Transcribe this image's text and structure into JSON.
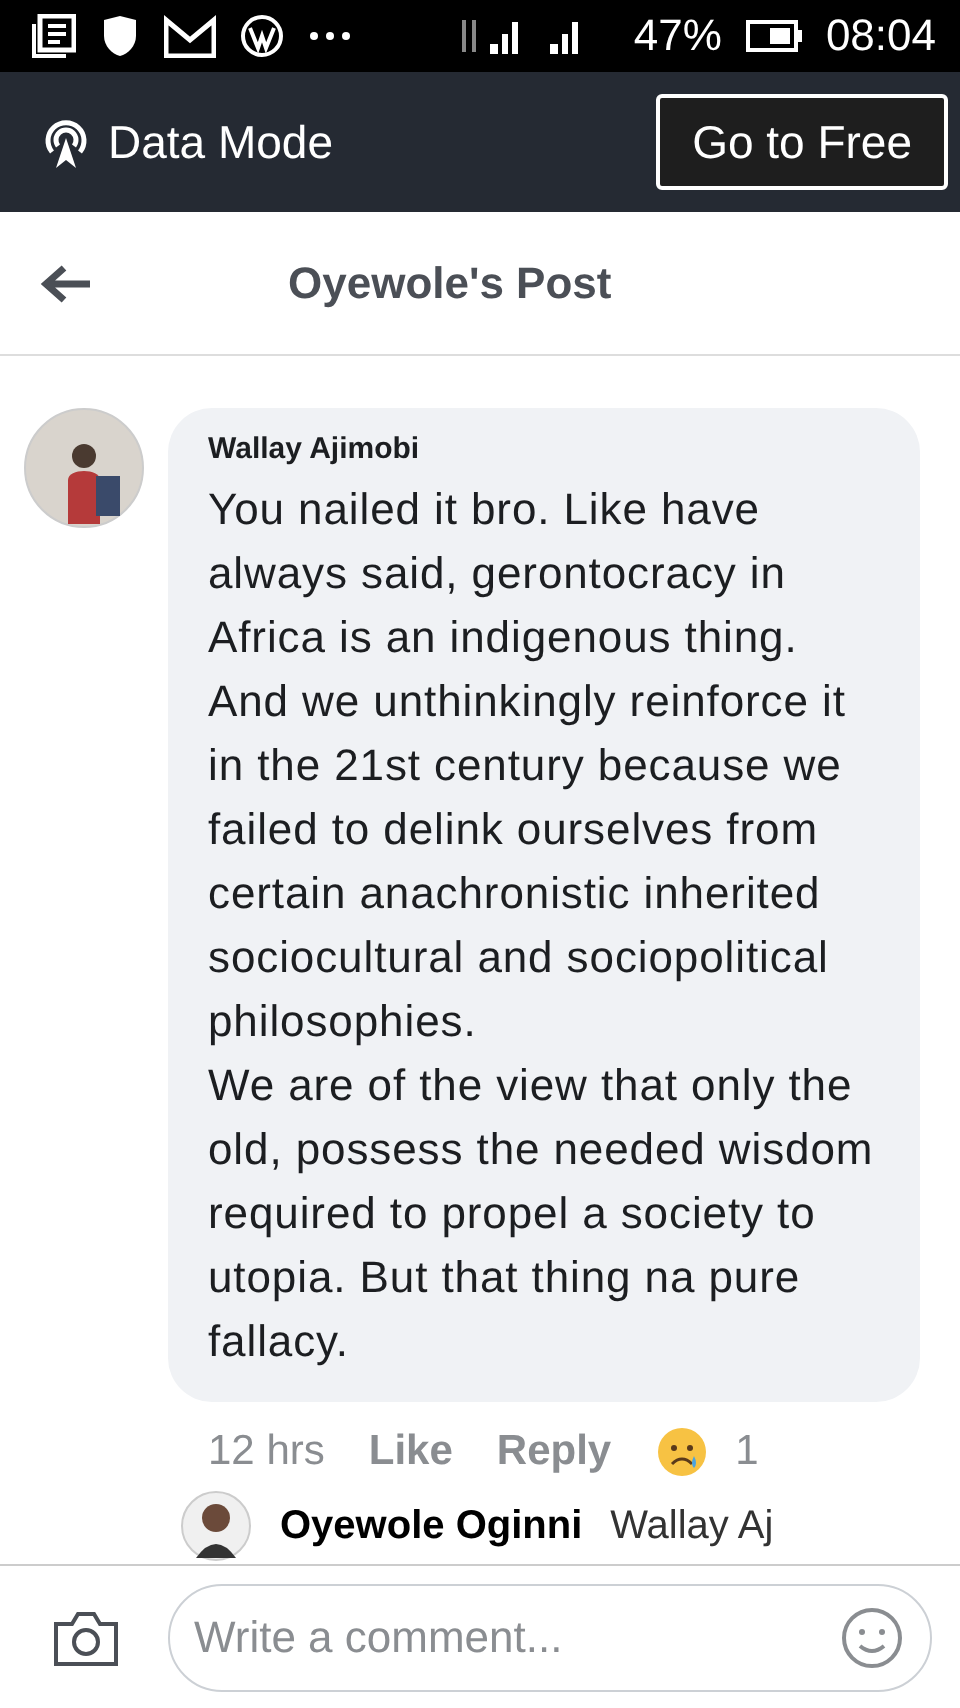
{
  "status_bar": {
    "battery": "47%",
    "time": "08:04"
  },
  "data_bar": {
    "label": "Data Mode",
    "button": "Go to Free"
  },
  "header": {
    "title": "Oyewole's Post"
  },
  "comment": {
    "author": "Wallay Ajimobi",
    "paragraphs": [
      "You nailed it bro. Like have always said, gerontocracy in Africa is an indigenous thing. And we unthinkingly reinforce it in the 21st century because we failed to delink ourselves from certain anachronistic inherited sociocultural and sociopolitical philosophies.",
      "We are of the view that only the old, possess the needed wisdom required to propel a society to utopia. But that thing na pure fallacy."
    ],
    "time": "12 hrs",
    "actions": [
      "Like",
      "Reply"
    ],
    "reaction_count": "1"
  },
  "reply": {
    "author": "Oyewole Oginni",
    "text": "Wallay Aj"
  },
  "composer": {
    "placeholder": "Write a comment..."
  }
}
